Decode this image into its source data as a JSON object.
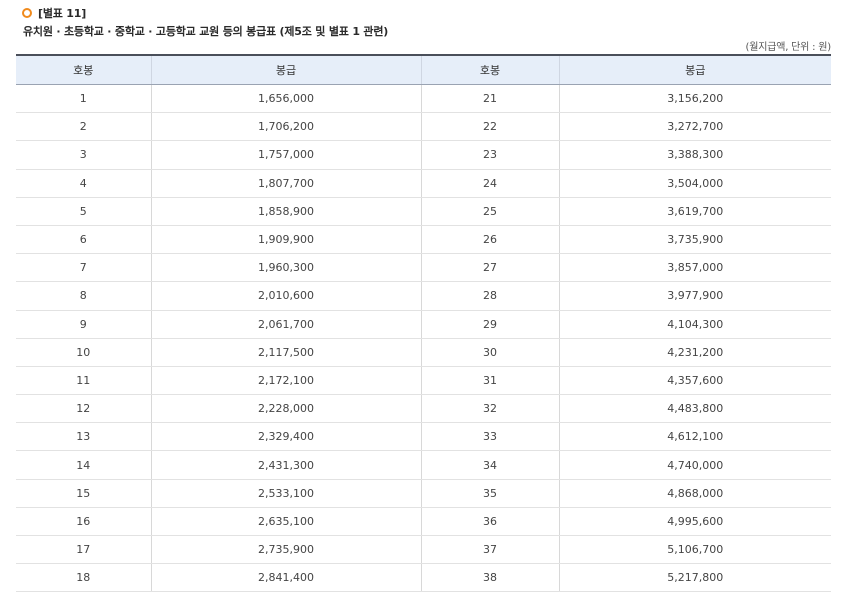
{
  "header": {
    "label": "[별표 11]",
    "subtitle": "유치원 · 초등학교 · 중학교 · 고등학교 교원 등의 봉급표 (제5조 및 별표 1 관련)",
    "unit": "(월지급액, 단위 : 원)"
  },
  "table": {
    "headers": [
      "호봉",
      "봉급",
      "호봉",
      "봉급"
    ],
    "rows": [
      [
        "1",
        "1,656,000",
        "21",
        "3,156,200"
      ],
      [
        "2",
        "1,706,200",
        "22",
        "3,272,700"
      ],
      [
        "3",
        "1,757,000",
        "23",
        "3,388,300"
      ],
      [
        "4",
        "1,807,700",
        "24",
        "3,504,000"
      ],
      [
        "5",
        "1,858,900",
        "25",
        "3,619,700"
      ],
      [
        "6",
        "1,909,900",
        "26",
        "3,735,900"
      ],
      [
        "7",
        "1,960,300",
        "27",
        "3,857,000"
      ],
      [
        "8",
        "2,010,600",
        "28",
        "3,977,900"
      ],
      [
        "9",
        "2,061,700",
        "29",
        "4,104,300"
      ],
      [
        "10",
        "2,117,500",
        "30",
        "4,231,200"
      ],
      [
        "11",
        "2,172,100",
        "31",
        "4,357,600"
      ],
      [
        "12",
        "2,228,000",
        "32",
        "4,483,800"
      ],
      [
        "13",
        "2,329,400",
        "33",
        "4,612,100"
      ],
      [
        "14",
        "2,431,300",
        "34",
        "4,740,000"
      ],
      [
        "15",
        "2,533,100",
        "35",
        "4,868,000"
      ],
      [
        "16",
        "2,635,100",
        "36",
        "4,995,600"
      ],
      [
        "17",
        "2,735,900",
        "37",
        "5,106,700"
      ],
      [
        "18",
        "2,841,400",
        "38",
        "5,217,800"
      ]
    ]
  },
  "colors": {
    "accent": "#f08a1c",
    "header_bg": "#e6eef9"
  },
  "icons": {
    "bullet": "orange-ring-icon"
  }
}
